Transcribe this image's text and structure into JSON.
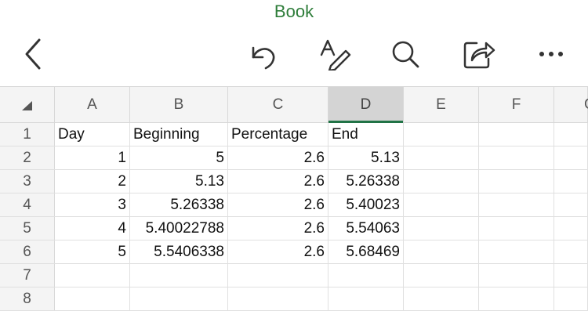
{
  "app": {
    "title": "Book"
  },
  "toolbar": {
    "back_icon": "chevron-left-icon",
    "undo_icon": "undo-icon",
    "draw_icon": "text-pen-icon",
    "search_icon": "search-icon",
    "share_icon": "share-icon",
    "more_icon": "more-icon"
  },
  "colors": {
    "title": "#2e7d3a",
    "selected_column_accent": "#217346"
  },
  "sheet": {
    "columns": [
      "A",
      "B",
      "C",
      "D",
      "E",
      "F",
      "G"
    ],
    "selected_column": "D",
    "rows": [
      {
        "num": "1",
        "cells": [
          "Day",
          "Beginning",
          "Percentage",
          "End",
          "",
          "",
          ""
        ]
      },
      {
        "num": "2",
        "cells": [
          "1",
          "5",
          "2.6",
          "5.13",
          "",
          "",
          ""
        ]
      },
      {
        "num": "3",
        "cells": [
          "2",
          "5.13",
          "2.6",
          "5.26338",
          "",
          "",
          ""
        ]
      },
      {
        "num": "4",
        "cells": [
          "3",
          "5.26338",
          "2.6",
          "5.40023",
          "",
          "",
          ""
        ]
      },
      {
        "num": "5",
        "cells": [
          "4",
          "5.40022788",
          "2.6",
          "5.54063",
          "",
          "",
          ""
        ]
      },
      {
        "num": "6",
        "cells": [
          "5",
          "5.5406338",
          "2.6",
          "5.68469",
          "",
          "",
          ""
        ]
      },
      {
        "num": "7",
        "cells": [
          "",
          "",
          "",
          "",
          "",
          "",
          ""
        ]
      },
      {
        "num": "8",
        "cells": [
          "",
          "",
          "",
          "",
          "",
          "",
          ""
        ]
      }
    ]
  }
}
